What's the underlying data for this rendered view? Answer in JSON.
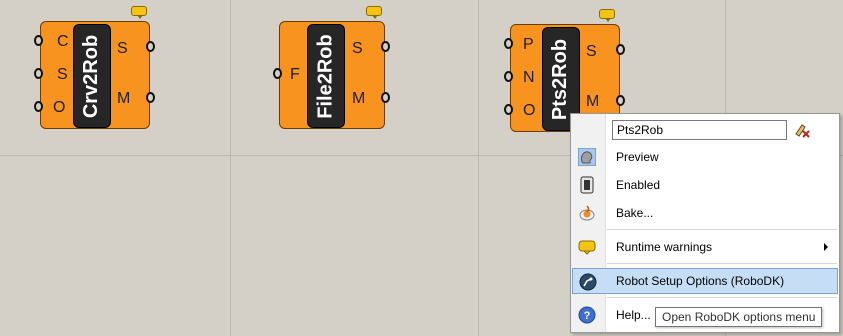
{
  "components": [
    {
      "name": "Crv2Rob",
      "inputs": [
        "C",
        "S",
        "O"
      ],
      "outputs": [
        "S",
        "M"
      ]
    },
    {
      "name": "File2Rob",
      "inputs": [
        "F"
      ],
      "outputs": [
        "S",
        "M"
      ]
    },
    {
      "name": "Pts2Rob",
      "inputs": [
        "P",
        "N",
        "O"
      ],
      "outputs": [
        "S",
        "M"
      ]
    }
  ],
  "context_menu": {
    "name_field_value": "Pts2Rob",
    "items": [
      {
        "label": "Preview",
        "icon": "preview-icon"
      },
      {
        "label": "Enabled",
        "icon": "enabled-icon"
      },
      {
        "label": "Bake...",
        "icon": "bake-icon"
      },
      {
        "label": "Runtime warnings",
        "icon": "warning-icon",
        "has_submenu": true
      },
      {
        "label": "Robot Setup Options (RoboDK)",
        "icon": "robodk-icon",
        "highlighted": true
      },
      {
        "label": "Help...",
        "icon": "help-icon"
      }
    ]
  },
  "tooltip": {
    "text": "Open RoboDK options menu"
  },
  "colors": {
    "component": "#f7931e",
    "canvas": "#d4d0c8",
    "highlight": "#c5def5"
  }
}
